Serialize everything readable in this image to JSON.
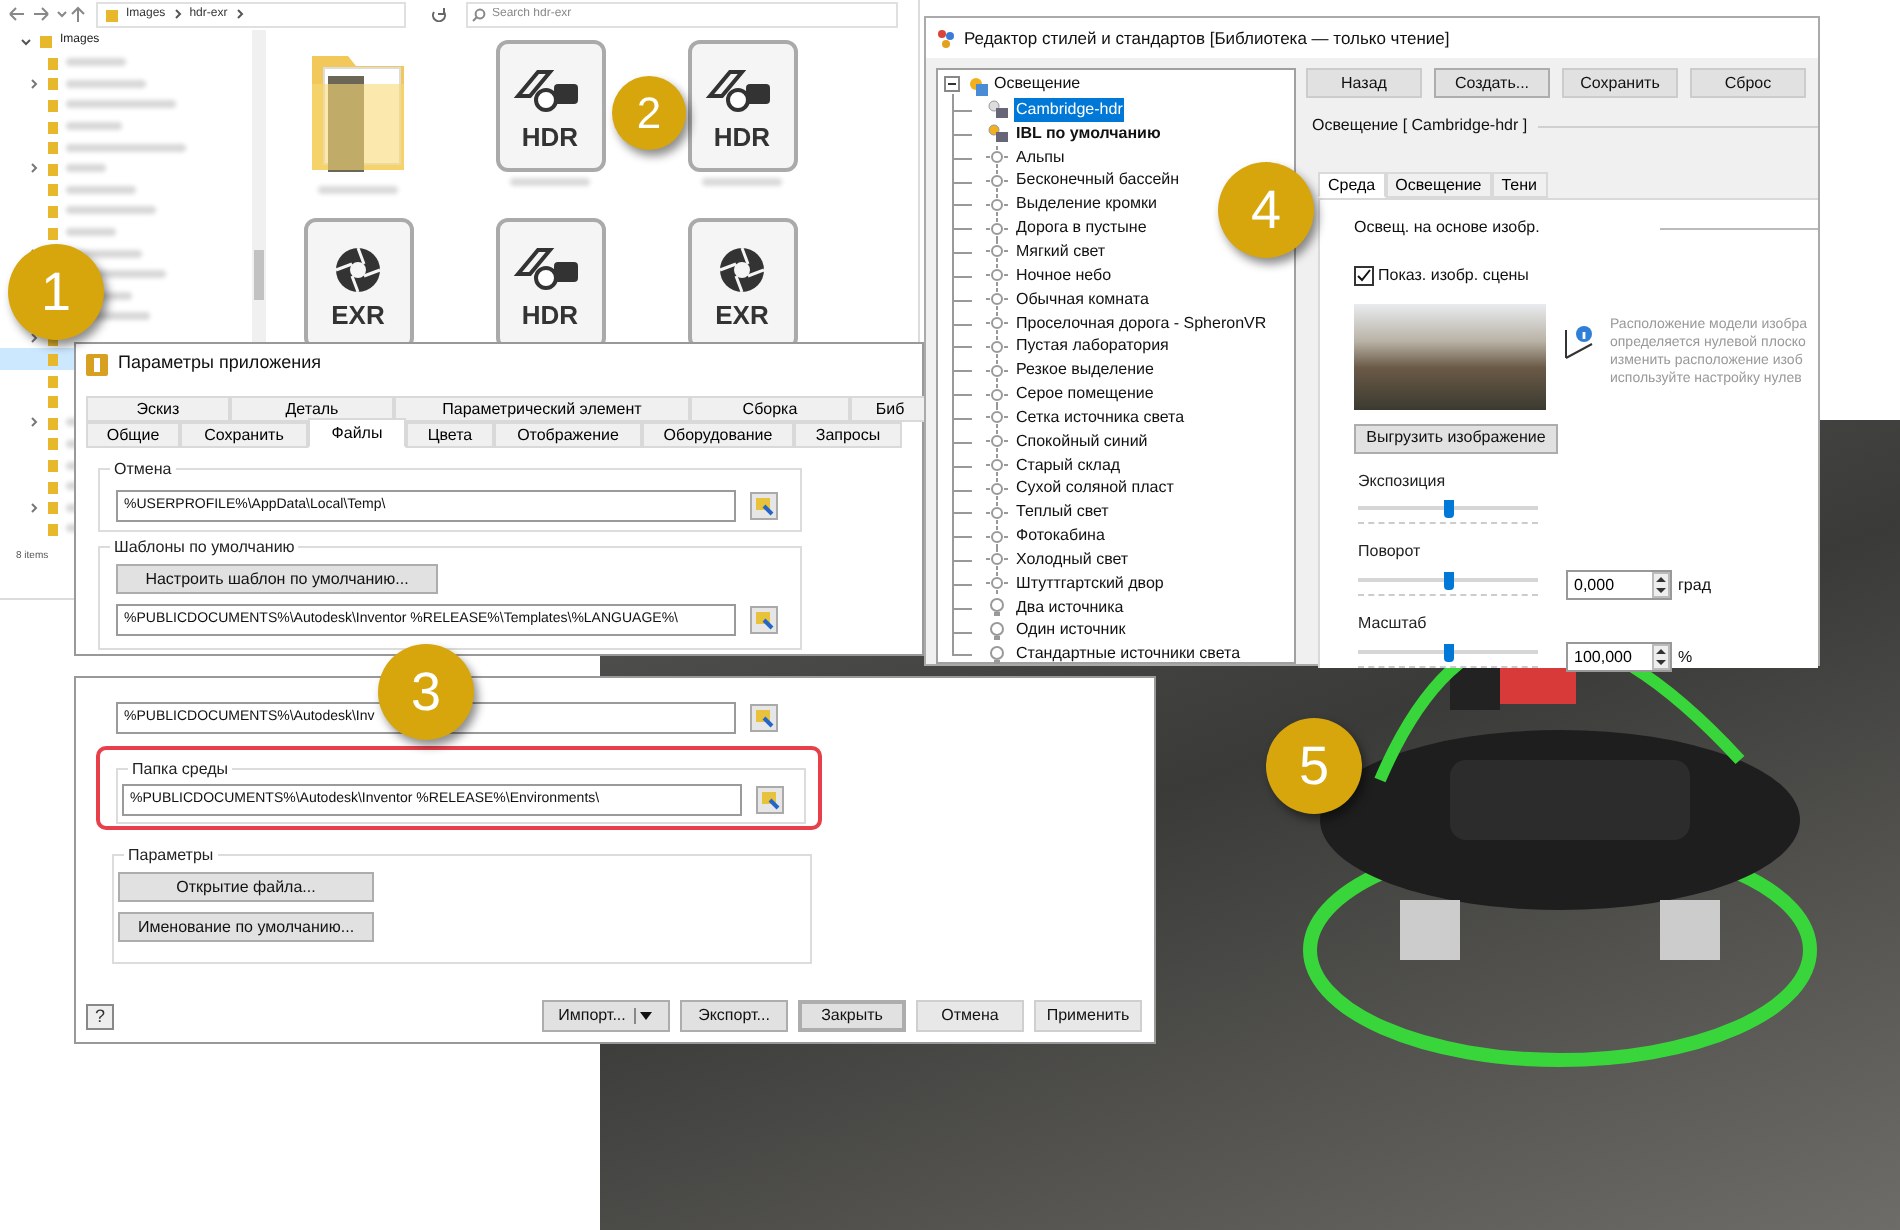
{
  "explorer": {
    "breadcrumb": [
      "Images",
      "hdr-exr"
    ],
    "search": {
      "placeholder": "Search hdr-exr"
    },
    "tree_root": "Images",
    "status": "8 items",
    "files": [
      {
        "kind": "folder"
      },
      {
        "kind": "hdr",
        "label": "HDR"
      },
      {
        "kind": "hdr",
        "label": "HDR"
      },
      {
        "kind": "exr",
        "label": "EXR"
      },
      {
        "kind": "hdr",
        "label": "HDR"
      },
      {
        "kind": "exr",
        "label": "EXR"
      }
    ]
  },
  "callouts": [
    "1",
    "2",
    "3",
    "4",
    "5"
  ],
  "app_options": {
    "title": "Параметры приложения",
    "tabs_row1": [
      {
        "label": "Эскиз",
        "selected": false
      },
      {
        "label": "Деталь",
        "selected": false
      },
      {
        "label": "Параметрический элемент",
        "selected": false
      },
      {
        "label": "Сборка",
        "selected": false
      },
      {
        "label": "Биб",
        "selected": false
      }
    ],
    "tabs_row2": [
      {
        "label": "Общие",
        "selected": false
      },
      {
        "label": "Сохранить",
        "selected": false
      },
      {
        "label": "Файлы",
        "selected": true
      },
      {
        "label": "Цвета",
        "selected": false
      },
      {
        "label": "Отображение",
        "selected": false
      },
      {
        "label": "Оборудование",
        "selected": false
      },
      {
        "label": "Запросы",
        "selected": false
      }
    ],
    "undo_group": {
      "title": "Отмена",
      "path": "%USERPROFILE%\\AppData\\Local\\Temp\\"
    },
    "templates_group": {
      "title": "Шаблоны по умолчанию",
      "button": "Настроить шаблон по умолчанию...",
      "path": "%PUBLICDOCUMENTS%\\Autodesk\\Inventor %RELEASE%\\Templates\\%LANGUAGE%\\"
    },
    "partial_path": "%PUBLICDOCUMENTS%\\Autodesk\\Inv",
    "environment_group": {
      "title": "Папка среды",
      "highlighted": true,
      "path": "%PUBLICDOCUMENTS%\\Autodesk\\Inventor %RELEASE%\\Environments\\"
    },
    "options_group": {
      "title": "Параметры",
      "buttons": [
        "Открытие файла...",
        "Именование по умолчанию..."
      ]
    },
    "help": "?",
    "footer_buttons": [
      {
        "label": "Импорт...",
        "kind": "split",
        "disabled": false
      },
      {
        "label": "Экспорт...",
        "kind": "plain",
        "disabled": false
      },
      {
        "label": "Закрыть",
        "kind": "default",
        "disabled": false
      },
      {
        "label": "Отмена",
        "kind": "plain",
        "disabled": true
      },
      {
        "label": "Применить",
        "kind": "plain",
        "disabled": true
      }
    ]
  },
  "style_editor": {
    "title": "Редактор стилей и стандартов [Библиотека — только чтение]",
    "tree": {
      "label": "Освещение",
      "expanded": true,
      "children": [
        {
          "label": "Cambridge-hdr",
          "kind": "hdr",
          "selected": true,
          "default": false
        },
        {
          "label": "IBL по умолчанию",
          "kind": "hdr",
          "selected": false,
          "default": true
        },
        {
          "label": "Альпы",
          "kind": "sun",
          "selected": false,
          "default": false
        },
        {
          "label": "Бесконечный бассейн",
          "kind": "sun",
          "selected": false,
          "default": false
        },
        {
          "label": "Выделение кромки",
          "kind": "sun",
          "selected": false,
          "default": false
        },
        {
          "label": "Дорога в пустыне",
          "kind": "sun",
          "selected": false,
          "default": false
        },
        {
          "label": "Мягкий свет",
          "kind": "sun",
          "selected": false,
          "default": false
        },
        {
          "label": "Ночное небо",
          "kind": "sun",
          "selected": false,
          "default": false
        },
        {
          "label": "Обычная комната",
          "kind": "sun",
          "selected": false,
          "default": false
        },
        {
          "label": "Проселочная дорога - SpheronVR",
          "kind": "sun",
          "selected": false,
          "default": false
        },
        {
          "label": "Пустая лаборатория",
          "kind": "sun",
          "selected": false,
          "default": false
        },
        {
          "label": "Резкое выделение",
          "kind": "sun",
          "selected": false,
          "default": false
        },
        {
          "label": "Серое помещение",
          "kind": "sun",
          "selected": false,
          "default": false
        },
        {
          "label": "Сетка источника света",
          "kind": "sun",
          "selected": false,
          "default": false
        },
        {
          "label": "Спокойный синий",
          "kind": "sun",
          "selected": false,
          "default": false
        },
        {
          "label": "Старый склад",
          "kind": "sun",
          "selected": false,
          "default": false
        },
        {
          "label": "Сухой соляной пласт",
          "kind": "sun",
          "selected": false,
          "default": false
        },
        {
          "label": "Теплый свет",
          "kind": "sun",
          "selected": false,
          "default": false
        },
        {
          "label": "Фотокабина",
          "kind": "sun",
          "selected": false,
          "default": false
        },
        {
          "label": "Холодный свет",
          "kind": "sun",
          "selected": false,
          "default": false
        },
        {
          "label": "Штуттгартский двор",
          "kind": "sun",
          "selected": false,
          "default": false
        },
        {
          "label": "Два источника",
          "kind": "bulb",
          "selected": false,
          "default": false
        },
        {
          "label": "Один источник",
          "kind": "bulb",
          "selected": false,
          "default": false
        },
        {
          "label": "Стандартные источники света",
          "kind": "bulb",
          "selected": false,
          "default": false
        }
      ]
    },
    "buttons": [
      {
        "label": "Назад",
        "disabled": true
      },
      {
        "label": "Создать...",
        "disabled": false
      },
      {
        "label": "Сохранить",
        "disabled": true
      },
      {
        "label": "Сброс",
        "disabled": true
      }
    ],
    "section_title": "Освещение [ Cambridge-hdr ]",
    "tabs": [
      {
        "label": "Среда",
        "selected": true
      },
      {
        "label": "Освещение",
        "selected": false
      },
      {
        "label": "Тени",
        "selected": false
      }
    ],
    "heading": "Освещ. на основе изобр.",
    "checkbox": {
      "label": "Показ. изобр. сцены",
      "checked": true
    },
    "info_lines": [
      "Расположение модели изобра",
      "определяется нулевой плоско",
      "изменить расположение изоб",
      "используйте настройку нулев"
    ],
    "unload_button": "Выгрузить изображение",
    "sliders": [
      {
        "label": "Экспозиция",
        "level": 0.5
      },
      {
        "label": "Поворот",
        "level": 0.5,
        "value": "0,000",
        "unit": "град"
      },
      {
        "label": "Масштаб",
        "level": 0.5,
        "value": "100,000",
        "unit": "%"
      }
    ]
  }
}
